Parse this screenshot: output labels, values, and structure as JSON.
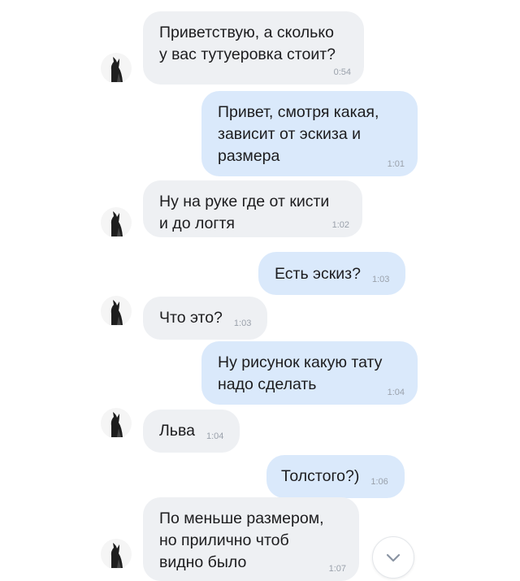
{
  "messages": [
    {
      "dir": "in",
      "text": "Приветствую, а сколько\nу вас тутуеровка стоит?",
      "time": "0:54"
    },
    {
      "dir": "out",
      "text": "Привет, смотря какая,\nзависит от эскиза и\nразмера",
      "time": "1:01"
    },
    {
      "dir": "in",
      "text": "Ну на руке где от кисти\nи до логтя",
      "time": "1:02"
    },
    {
      "dir": "out",
      "text": "Есть эскиз?",
      "time": "1:03"
    },
    {
      "dir": "in",
      "text": "Что это?",
      "time": "1:03"
    },
    {
      "dir": "out",
      "text": "Ну рисунок какую тату\nнадо сделать",
      "time": "1:04"
    },
    {
      "dir": "in",
      "text": "Льва",
      "time": "1:04"
    },
    {
      "dir": "out",
      "text": "Толстого?)",
      "time": "1:06"
    },
    {
      "dir": "in",
      "text": "По меньше размером,\nно прилично чтоб\nвидно было",
      "time": "1:07"
    }
  ],
  "icons": {
    "avatar": "contact-avatar",
    "scroll_down": "chevron-down-icon"
  },
  "colors": {
    "incoming_bubble": "#eef0f3",
    "outgoing_bubble": "#dae9fb",
    "text": "#1c1c1e",
    "time": "#9aa1ab"
  }
}
